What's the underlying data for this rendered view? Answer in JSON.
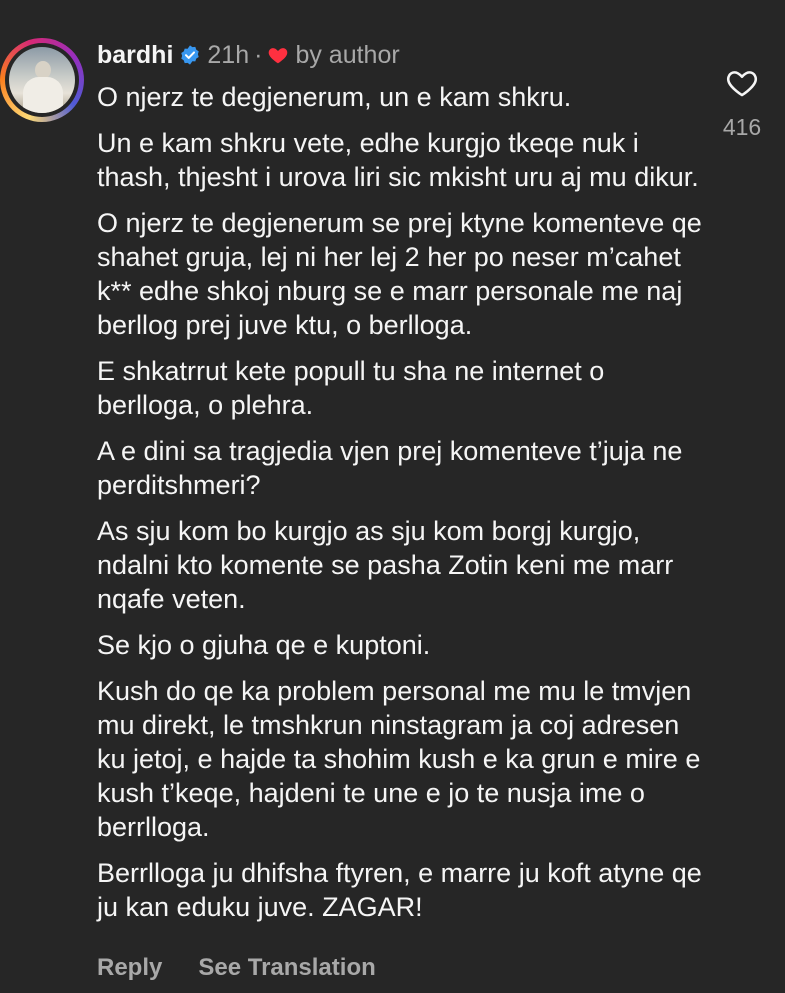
{
  "comment": {
    "username": "bardhi",
    "verified_icon": "verified-badge-icon",
    "time": "21h",
    "separator": "·",
    "liked_by_label": "by author",
    "like_count": "416",
    "paragraphs": [
      "O njerz te degjenerum, un e kam shkru.",
      "Un e kam shkru vete, edhe kurgjo tkeqe nuk i thash, thjesht i urova liri sic mkisht uru aj mu dikur.",
      "O njerz te degjenerum se prej ktyne komenteve qe shahet gruja, lej ni her lej 2 her po neser m’cahet k** edhe shkoj nburg se e marr personale me naj berllog prej juve ktu, o berlloga.",
      "E shkatrrut kete popull tu sha ne internet o berlloga, o plehra.",
      "A e dini sa tragjedia vjen prej komenteve t’juja ne perditshmeri?",
      "As sju kom bo kurgjo as sju kom borgj kurgjo, ndalni kto komente se pasha Zotin keni me marr nqafe veten.",
      "Se kjo o gjuha qe e kuptoni.",
      "Kush do qe ka problem personal me mu le tmvjen mu direkt, le tmshkrun ninstagram ja coj adresen ku jetoj, e hajde ta shohim kush e ka grun e mire e kush t’keqe, hajdeni te une e  jo te nusja ime o berrlloga.",
      "Berrlloga ju dhifsha ftyren,  e marre ju koft atyne qe ju kan eduku juve. ZAGAR!"
    ],
    "actions": {
      "reply_label": "Reply",
      "translate_label": "See Translation"
    }
  },
  "colors": {
    "background": "#262626",
    "text": "#f5f5f5",
    "secondary_text": "#a8a8a8",
    "verified_blue": "#3897f0",
    "heart_red": "#ff3040"
  }
}
